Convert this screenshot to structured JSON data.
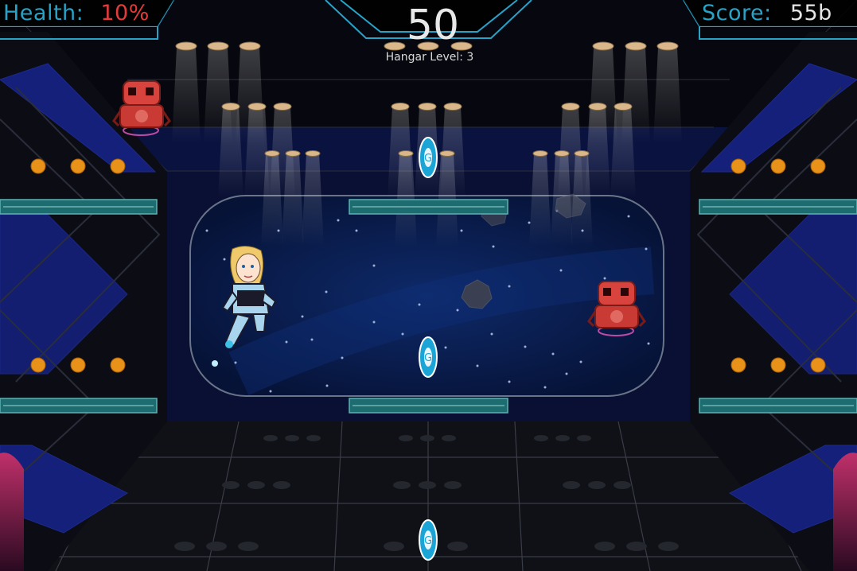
{
  "hud": {
    "health_label": "Health:",
    "health_value": "10%",
    "timer": "50",
    "level_text": "Hangar Level: 3",
    "score_label": "Score:",
    "score_value": "55b"
  },
  "entities": {
    "player": "astronaut-girl",
    "enemies": [
      "red-robot",
      "red-robot"
    ],
    "coins": [
      "g-coin",
      "g-coin",
      "g-coin"
    ],
    "asteroids": [
      "asteroid",
      "asteroid",
      "asteroid"
    ]
  },
  "colors": {
    "hud_accent": "#27a3c8",
    "health_value": "#e23b3b",
    "platform": "#1d6d70",
    "wall_blue": "#14207a",
    "window": "#0a1d4e",
    "robot": "#d9433e",
    "coin": "#1aa5d6"
  }
}
